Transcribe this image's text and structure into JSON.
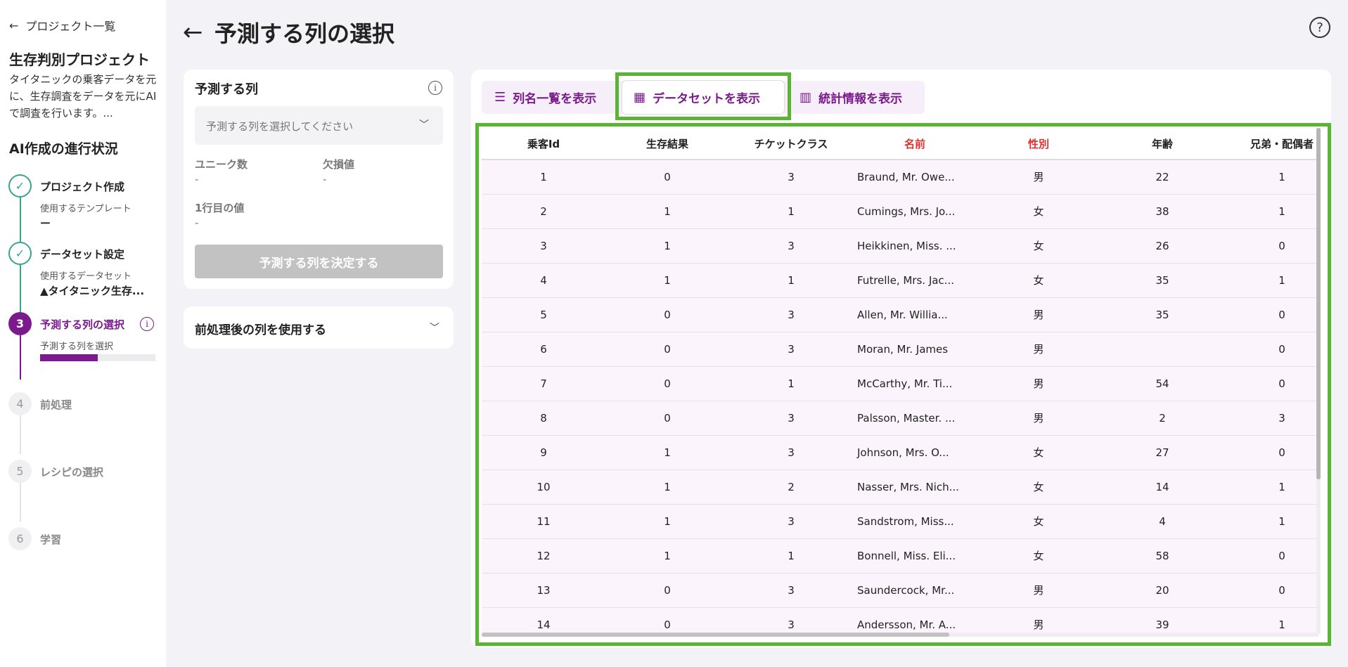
{
  "sidebar": {
    "back_label": "プロジェクト一覧",
    "project_title": "生存判別プロジェクト",
    "project_desc": "タイタニックの乗客データを元に、生存調査をデータを元にAIで調査を行います。...",
    "progress_title": "AI作成の進行状況",
    "steps": [
      {
        "num": "1",
        "label": "プロジェクト作成",
        "sub": "使用するテンプレート",
        "value": "ー",
        "state": "done"
      },
      {
        "num": "2",
        "label": "データセット設定",
        "sub": "使用するデータセット",
        "value": "▲タイタニック生存...",
        "state": "done"
      },
      {
        "num": "3",
        "label": "予測する列の選択",
        "sub": "予測する列を選択",
        "state": "active",
        "progress": 0.5
      },
      {
        "num": "4",
        "label": "前処理",
        "state": "todo"
      },
      {
        "num": "5",
        "label": "レシピの選択",
        "state": "todo"
      },
      {
        "num": "6",
        "label": "学習",
        "state": "todo"
      }
    ]
  },
  "header": {
    "title": "予測する列の選択"
  },
  "target_panel": {
    "title": "予測する列",
    "select_placeholder": "予測する列を選択してください",
    "unique_label": "ユニーク数",
    "unique_value": "-",
    "missing_label": "欠損値",
    "missing_value": "-",
    "first_row_label": "1行目の値",
    "first_row_value": "-",
    "decide_button": "予測する列を決定する"
  },
  "preprocess_panel": {
    "label": "前処理後の列を使用する"
  },
  "tabs": {
    "columns": "列名一覧を表示",
    "dataset": "データセットを表示",
    "stats": "統計情報を表示"
  },
  "table": {
    "headers": [
      "乗客Id",
      "生存結果",
      "チケットクラス",
      "名前",
      "性別",
      "年齢",
      "兄弟・配偶者"
    ],
    "rows": [
      [
        "1",
        "0",
        "3",
        "Braund, Mr. Owe...",
        "男",
        "22",
        "1"
      ],
      [
        "2",
        "1",
        "1",
        "Cumings, Mrs. Jo...",
        "女",
        "38",
        "1"
      ],
      [
        "3",
        "1",
        "3",
        "Heikkinen, Miss. ...",
        "女",
        "26",
        "0"
      ],
      [
        "4",
        "1",
        "1",
        "Futrelle, Mrs. Jac...",
        "女",
        "35",
        "1"
      ],
      [
        "5",
        "0",
        "3",
        "Allen, Mr. Willia...",
        "男",
        "35",
        "0"
      ],
      [
        "6",
        "0",
        "3",
        " Moran, Mr. James",
        "男",
        "",
        "0"
      ],
      [
        "7",
        "0",
        "1",
        "McCarthy, Mr. Ti...",
        "男",
        "54",
        "0"
      ],
      [
        "8",
        "0",
        "3",
        "Palsson, Master. ...",
        "男",
        "2",
        "3"
      ],
      [
        "9",
        "1",
        "3",
        "Johnson, Mrs. O...",
        "女",
        "27",
        "0"
      ],
      [
        "10",
        "1",
        "2",
        "Nasser, Mrs. Nich...",
        "女",
        "14",
        "1"
      ],
      [
        "11",
        "1",
        "3",
        "Sandstrom, Miss...",
        "女",
        "4",
        "1"
      ],
      [
        "12",
        "1",
        "1",
        "Bonnell, Miss. Eli...",
        "女",
        "58",
        "0"
      ],
      [
        "13",
        "0",
        "3",
        "Saundercock, Mr...",
        "男",
        "20",
        "0"
      ],
      [
        "14",
        "0",
        "3",
        "Andersson, Mr. A...",
        "男",
        "39",
        "1"
      ]
    ]
  },
  "colors": {
    "accent": "#7b1a8d",
    "done": "#3aa38f",
    "highlight": "#5bb534",
    "red_header": "#e03131"
  }
}
